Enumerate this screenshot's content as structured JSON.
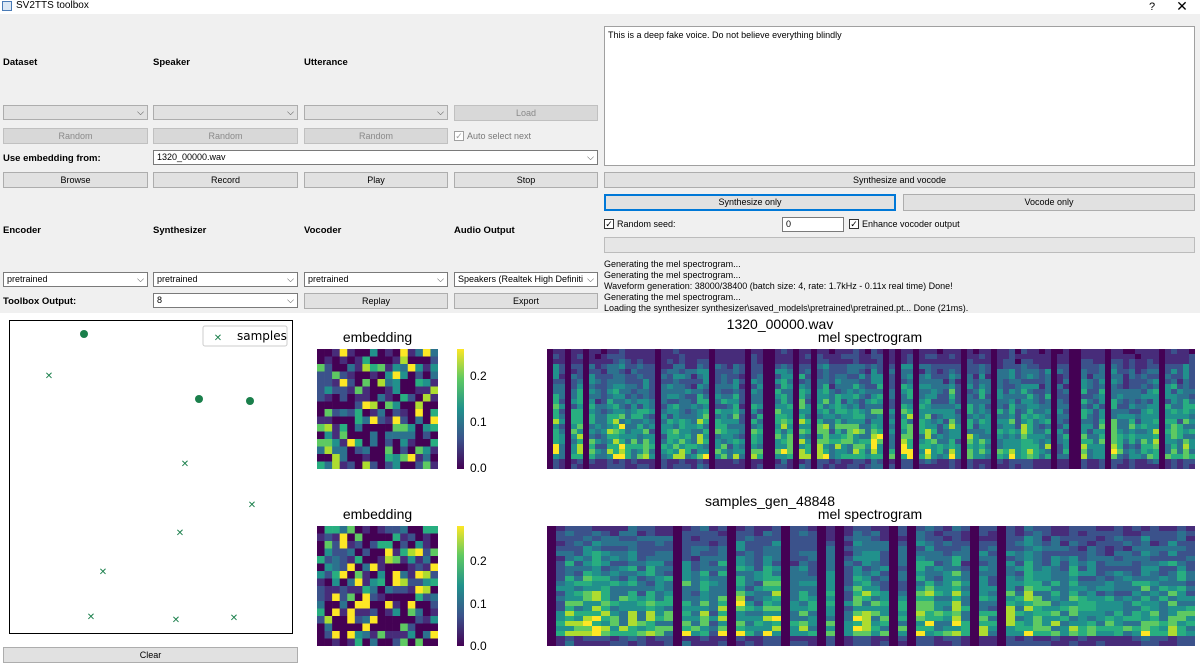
{
  "window": {
    "title": "SV2TTS toolbox",
    "help": "?",
    "close": "✕"
  },
  "labels": {
    "dataset": "Dataset",
    "speaker": "Speaker",
    "utterance": "Utterance",
    "use_embedding": "Use embedding from:",
    "encoder": "Encoder",
    "synthesizer": "Synthesizer",
    "vocoder": "Vocoder",
    "audio_output": "Audio Output",
    "toolbox_output": "Toolbox Output:"
  },
  "buttons": {
    "load": "Load",
    "random": "Random",
    "browse": "Browse",
    "record": "Record",
    "play": "Play",
    "stop": "Stop",
    "replay": "Replay",
    "export": "Export",
    "clear": "Clear",
    "synth_vocode": "Synthesize and vocode",
    "synth_only": "Synthesize only",
    "vocode_only": "Vocode only"
  },
  "checks": {
    "auto_select": "Auto select next",
    "random_seed": "Random seed:",
    "enhance": "Enhance vocoder output"
  },
  "inputs": {
    "embedding_file": "1320_00000.wav",
    "encoder": "pretrained",
    "synthesizer": "pretrained",
    "vocoder": "pretrained",
    "audio_output": "Speakers (Realtek High Definiti",
    "toolbox_output": "8",
    "seed": "0",
    "text": "This is a deep fake voice. Do not believe everything blindly"
  },
  "log": [
    "Generating the mel spectrogram...",
    "Generating the mel spectrogram...",
    "Waveform generation: 38000/38400 (batch size: 4, rate: 1.7kHz - 0.11x real time) Done!",
    "Generating the mel spectrogram...",
    "Loading the synthesizer synthesizer\\saved_models\\pretrained\\pretrained.pt... Done (21ms)."
  ],
  "plots": {
    "legend": "samples",
    "embedding_title": "embedding",
    "mel_title": "mel spectrogram",
    "top_file": "1320_00000.wav",
    "bottom_file": "samples_gen_48848",
    "colorbar_ticks_top": [
      "0.2",
      "0.1",
      "0.0"
    ],
    "colorbar_ticks_bottom": [
      "0.2",
      "0.1",
      "0.0"
    ]
  },
  "colors": {
    "accent": "#0078d7",
    "marker": "#1a7f4b"
  }
}
